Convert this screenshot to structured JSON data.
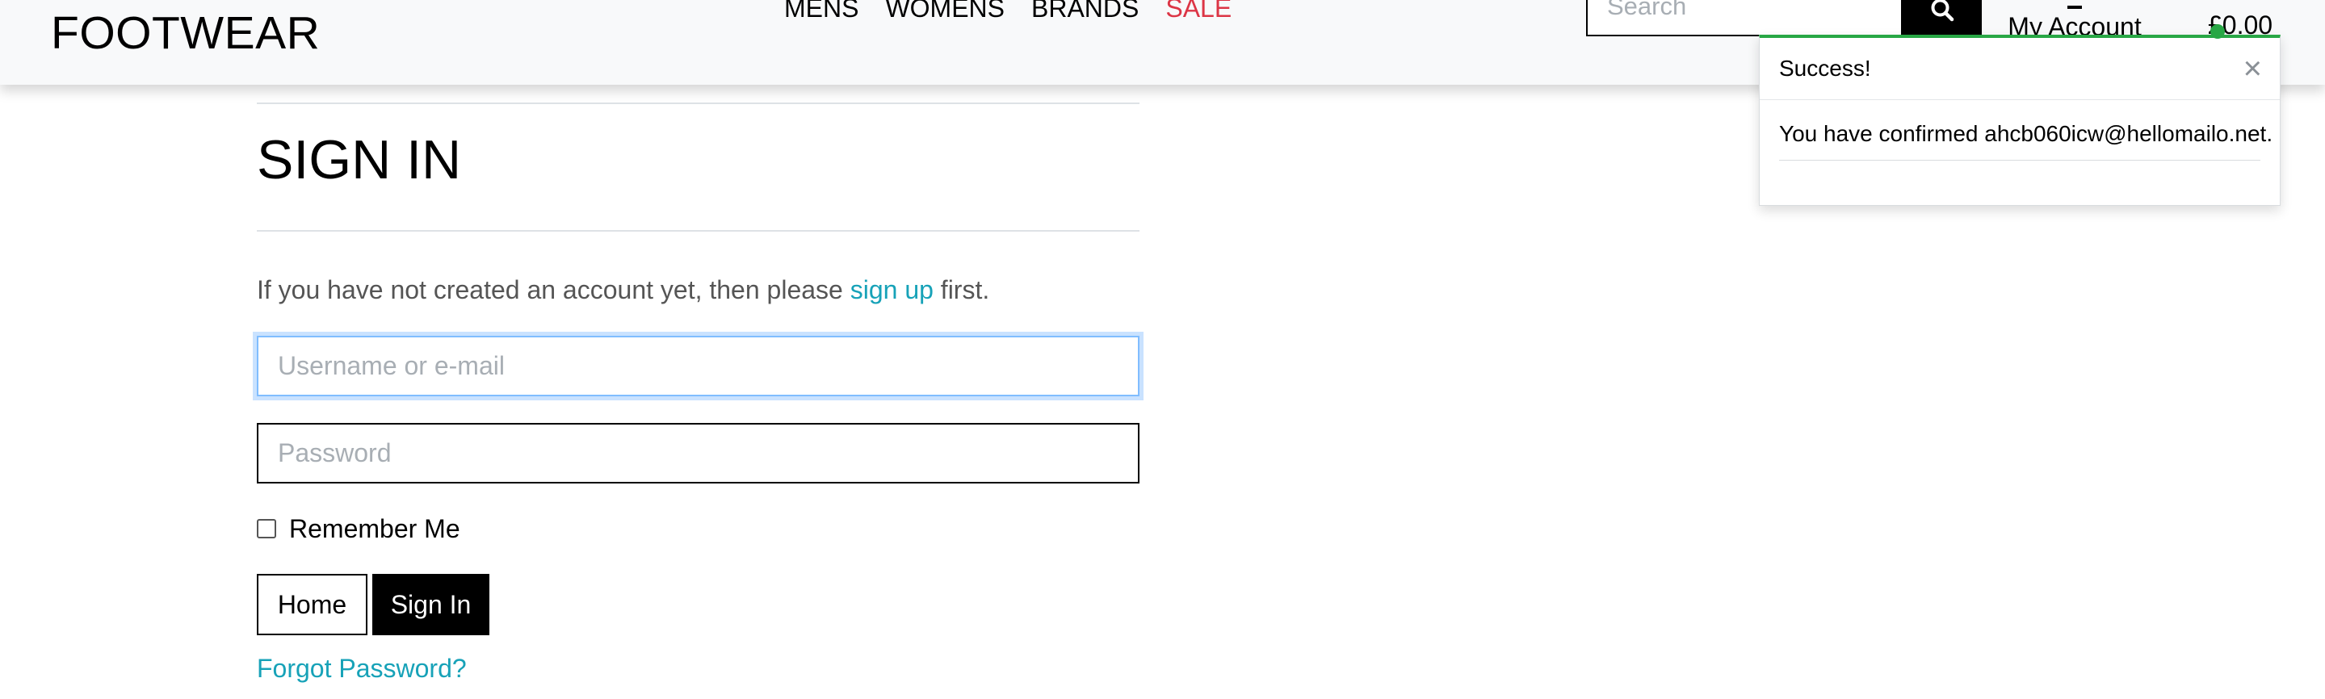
{
  "header": {
    "brand": "FOOTWEAR",
    "nav": {
      "mens": "MENS",
      "womens": "WOMENS",
      "brands": "BRANDS",
      "sale": "SALE"
    },
    "search": {
      "placeholder": "Search",
      "icon": "search-icon"
    },
    "account": {
      "label": "My Account",
      "icon": "user-icon"
    },
    "basket": {
      "total": "£0.00"
    }
  },
  "toast": {
    "title": "Success!",
    "close_symbol": "×",
    "message": "You have confirmed ahcb060icw@hellomailo.net."
  },
  "main": {
    "title": "SIGN IN",
    "signup_prompt": {
      "before": "If you have not created an account yet, then please ",
      "link": "sign up",
      "after": " first."
    },
    "username_placeholder": "Username or e-mail",
    "password_placeholder": "Password",
    "remember_label": "Remember Me",
    "home_label": "Home",
    "signin_label": "Sign In",
    "forgot_label": "Forgot Password?"
  },
  "colors": {
    "sale": "#dc3545",
    "link": "#17a2b8",
    "success": "#28a745",
    "focus": "#80bdff"
  }
}
